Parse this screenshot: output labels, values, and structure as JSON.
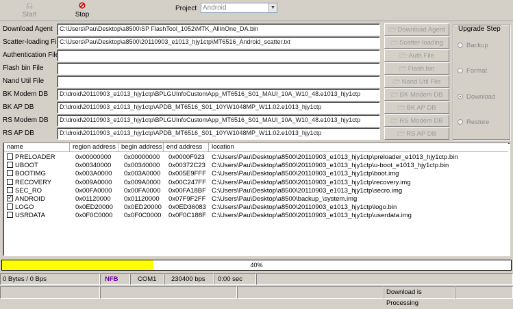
{
  "toolbar": {
    "start_label": "Start",
    "stop_label": "Stop",
    "project_label": "Project",
    "project_value": "Android"
  },
  "fields": [
    {
      "label": "Download Agent",
      "value": "C:\\Users\\Pau\\Desktop\\a8500\\SP FlashTool_1052\\MTK_AllInOne_DA.bin",
      "button": "Download Agent"
    },
    {
      "label": "Scatter-loading File",
      "value": "C:\\Users\\Pau\\Desktop\\a8500\\20110903_e1013_hjy1ctp\\MT6516_Android_scatter.txt",
      "button": "Scatter-loading"
    },
    {
      "label": "Authentication File",
      "value": "",
      "button": "Auth File"
    },
    {
      "label": "Flash bin File",
      "value": "",
      "button": "Flash.bin"
    },
    {
      "label": "Nand Util File",
      "value": "",
      "button": "Nand Util File"
    },
    {
      "label": "BK Modem DB",
      "value": "D:\\droid\\20110903_e1013_hjy1ctp\\BPLGUInfoCustomApp_MT6516_S01_MAUI_10A_W10_48.e1013_hjy1ctp",
      "button": "BK Modem DB"
    },
    {
      "label": "BK AP DB",
      "value": "D:\\droid\\20110903_e1013_hjy1ctp\\APDB_MT6516_S01_10YW1048MP_W11.02.e1013_hjy1ctp",
      "button": "BK AP DB"
    },
    {
      "label": "RS Modem DB",
      "value": "D:\\droid\\20110903_e1013_hjy1ctp\\BPLGUInfoCustomApp_MT6516_S01_MAUI_10A_W10_48.e1013_hjy1ctp",
      "button": "RS Modem DB"
    },
    {
      "label": "RS AP DB",
      "value": "D:\\droid\\20110903_e1013_hjy1ctp\\APDB_MT6516_S01_10YW1048MP_W11.02.e1013_hjy1ctp",
      "button": "RS AP DB"
    }
  ],
  "upgrade": {
    "title": "Upgrade Step",
    "options": [
      {
        "label": "Backup",
        "selected": false
      },
      {
        "label": "Format",
        "selected": false
      },
      {
        "label": "Download",
        "selected": true
      },
      {
        "label": "Restore",
        "selected": false
      }
    ]
  },
  "table": {
    "columns": [
      "name",
      "region address",
      "begin address",
      "end address",
      "location"
    ],
    "rows": [
      {
        "checked": false,
        "name": "PRELOADER",
        "region": "0x00000000",
        "begin": "0x00000000",
        "end": "0x0000F923",
        "location": "C:\\Users\\Pau\\Desktop\\a8500\\20110903_e1013_hjy1ctp\\preloader_e1013_hjy1ctp.bin"
      },
      {
        "checked": false,
        "name": "UBOOT",
        "region": "0x00340000",
        "begin": "0x00340000",
        "end": "0x00372C23",
        "location": "C:\\Users\\Pau\\Desktop\\a8500\\20110903_e1013_hjy1ctp\\u-boot_e1013_hjy1ctp.bin"
      },
      {
        "checked": false,
        "name": "BOOTIMG",
        "region": "0x003A0000",
        "begin": "0x003A0000",
        "end": "0x005E9FFF",
        "location": "C:\\Users\\Pau\\Desktop\\a8500\\20110903_e1013_hjy1ctp\\boot.img"
      },
      {
        "checked": false,
        "name": "RECOVERY",
        "region": "0x009A0000",
        "begin": "0x009A0000",
        "end": "0x00C247FF",
        "location": "C:\\Users\\Pau\\Desktop\\a8500\\20110903_e1013_hjy1ctp\\recovery.img"
      },
      {
        "checked": false,
        "name": "SEC_RO",
        "region": "0x00FA0000",
        "begin": "0x00FA0000",
        "end": "0x00FA18BF",
        "location": "C:\\Users\\Pau\\Desktop\\a8500\\20110903_e1013_hjy1ctp\\secro.img"
      },
      {
        "checked": true,
        "name": "ANDROID",
        "region": "0x01120000",
        "begin": "0x01120000",
        "end": "0x07F9F2FF",
        "location": "C:\\Users\\Pau\\Desktop\\a8500\\backup_\\system.img"
      },
      {
        "checked": false,
        "name": "LOGO",
        "region": "0x0ED20000",
        "begin": "0x0ED20000",
        "end": "0x0ED36083",
        "location": "C:\\Users\\Pau\\Desktop\\a8500\\20110903_e1013_hjy1ctp\\logo.bin"
      },
      {
        "checked": false,
        "name": "USRDATA",
        "region": "0x0F0C0000",
        "begin": "0x0F0C0000",
        "end": "0x0F0C188F",
        "location": "C:\\Users\\Pau\\Desktop\\a8500\\20110903_e1013_hjy1ctp\\userdata.img"
      }
    ]
  },
  "progress": {
    "percent": 40,
    "label": "40%",
    "color": "#ffff00"
  },
  "status": {
    "bytes": "0 Bytes / 0 Bps",
    "nfb": "NFB",
    "nfb_color": "#7000a0",
    "port": "COM1",
    "baud": "230400 bps",
    "time": "0:00 sec",
    "message": "Download is Processing"
  }
}
